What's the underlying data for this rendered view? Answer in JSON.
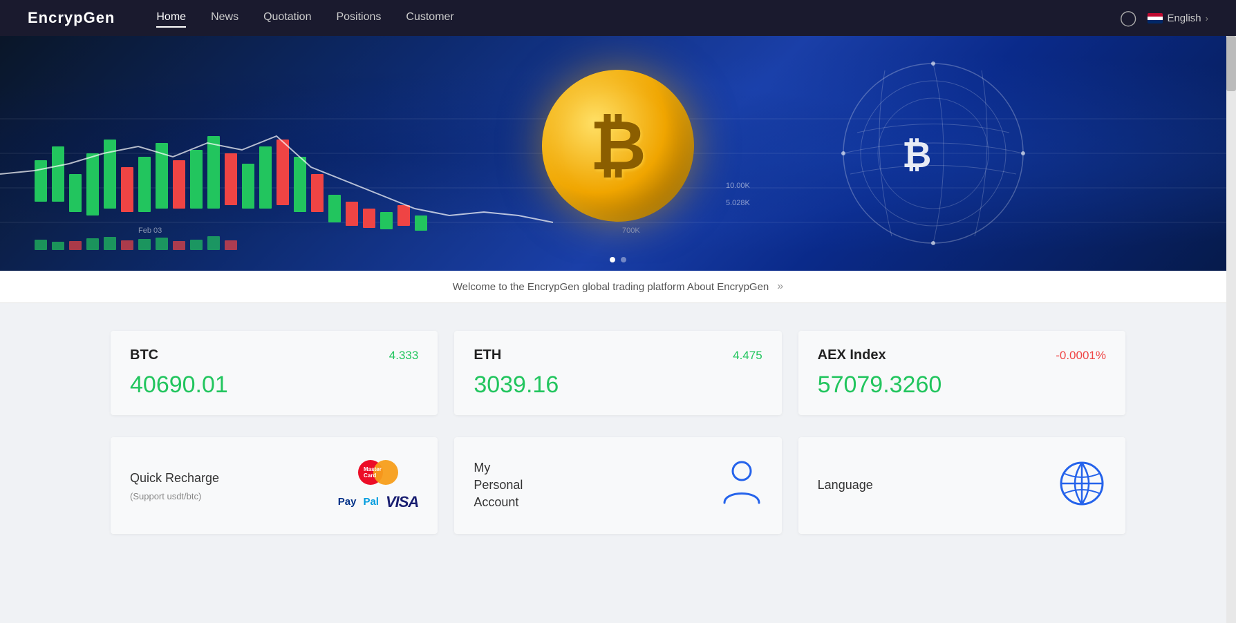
{
  "brand": "EncrypGen",
  "nav": {
    "items": [
      {
        "label": "Home",
        "active": true
      },
      {
        "label": "News",
        "active": false
      },
      {
        "label": "Quotation",
        "active": false
      },
      {
        "label": "Positions",
        "active": false
      },
      {
        "label": "Customer",
        "active": false
      }
    ]
  },
  "header_right": {
    "language": "English",
    "chevron": "›"
  },
  "welcome": {
    "text": "Welcome to the EncrypGen global trading platform About EncrypGen",
    "chevron": "»"
  },
  "prices": [
    {
      "ticker": "BTC",
      "change": "4.333",
      "change_type": "positive",
      "value": "40690.01"
    },
    {
      "ticker": "ETH",
      "change": "4.475",
      "change_type": "positive",
      "value": "3039.16"
    },
    {
      "ticker": "AEX Index",
      "change": "-0.0001%",
      "change_type": "negative",
      "value": "57079.3260"
    }
  ],
  "actions": [
    {
      "id": "quick-recharge",
      "title": "Quick Recharge",
      "subtitle": "(Support usdt/btc)"
    },
    {
      "id": "my-personal-account",
      "title": "My Personal Account",
      "subtitle": ""
    },
    {
      "id": "language",
      "title": "Language",
      "subtitle": ""
    }
  ],
  "indicators": [
    {
      "active": true
    },
    {
      "active": false
    }
  ]
}
